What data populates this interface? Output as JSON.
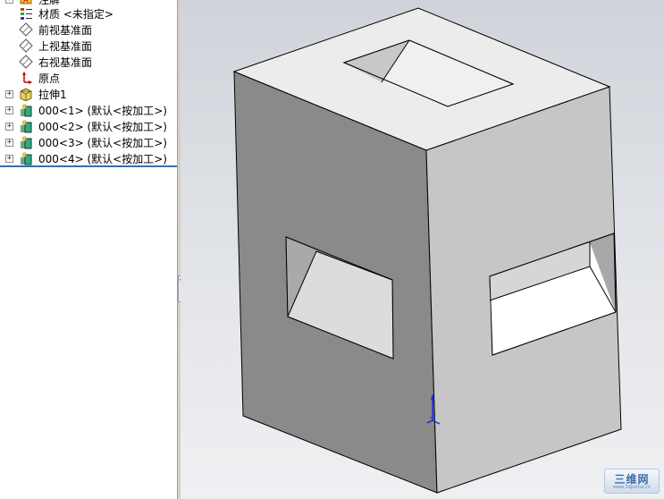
{
  "tree": {
    "items": [
      {
        "label": "注解",
        "icon": "annotations-icon",
        "expand": "+"
      },
      {
        "label": "材质 <未指定>",
        "icon": "material-icon",
        "expand": ""
      },
      {
        "label": "前视基准面",
        "icon": "plane-icon",
        "expand": ""
      },
      {
        "label": "上视基准面",
        "icon": "plane-icon",
        "expand": ""
      },
      {
        "label": "右视基准面",
        "icon": "plane-icon",
        "expand": ""
      },
      {
        "label": "原点",
        "icon": "origin-icon",
        "expand": ""
      },
      {
        "label": "拉伸1",
        "icon": "extrude-icon",
        "expand": "+"
      },
      {
        "label": "000<1> (默认<按加工>)",
        "icon": "part-icon",
        "expand": "+"
      },
      {
        "label": "000<2> (默认<按加工>)",
        "icon": "part-icon",
        "expand": "+"
      },
      {
        "label": "000<3> (默认<按加工>)",
        "icon": "part-icon",
        "expand": "+"
      },
      {
        "label": "000<4> (默认<按加工>)",
        "icon": "part-icon",
        "expand": "+"
      }
    ]
  },
  "splitter": {
    "handle_glyph": "‹‹"
  },
  "watermark": {
    "text": "三维网",
    "sub": "www.3dportal.cn"
  },
  "colors": {
    "top_face": "#ececec",
    "left_face": "#8a8a8a",
    "right_face": "#c8c8c8",
    "edge": "#000000",
    "tree_accent": "#3a6ea5"
  }
}
